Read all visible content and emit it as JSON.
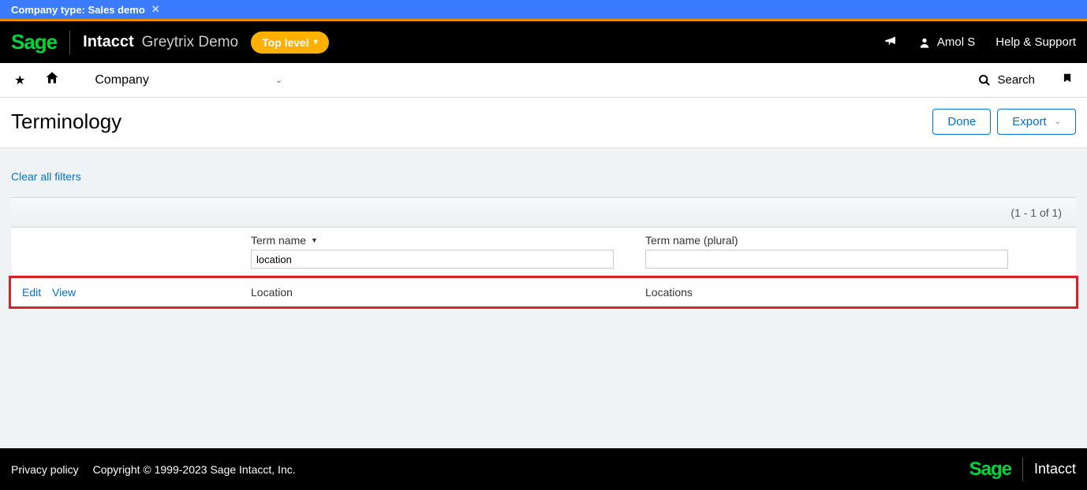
{
  "banner": {
    "text": "Company type: Sales demo"
  },
  "header": {
    "logo": "Sage",
    "product": "Intacct",
    "company": "Greytrix Demo",
    "top_level": "Top level",
    "user": "Amol S",
    "help": "Help & Support"
  },
  "nav": {
    "module": "Company",
    "search": "Search"
  },
  "page": {
    "title": "Terminology",
    "done": "Done",
    "export": "Export",
    "clear_filters": "Clear all filters"
  },
  "table": {
    "pager": "(1 - 1 of 1)",
    "col_term": "Term name",
    "col_plural": "Term name (plural)",
    "filter_term_value": "location",
    "filter_plural_value": "",
    "rows": [
      {
        "edit": "Edit",
        "view": "View",
        "term": "Location",
        "plural": "Locations"
      }
    ]
  },
  "footer": {
    "privacy": "Privacy policy",
    "copyright": "Copyright © 1999-2023 Sage Intacct, Inc.",
    "logo": "Sage",
    "product": "Intacct"
  }
}
